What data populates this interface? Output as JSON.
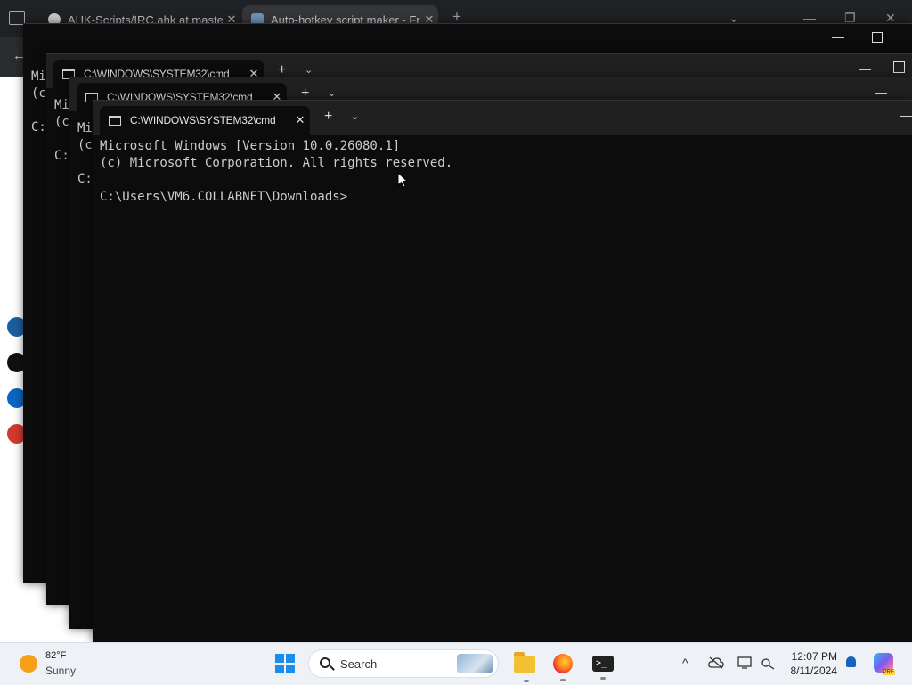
{
  "browser": {
    "tabs": [
      {
        "label": "AHK-Scripts/IRC.ahk at master"
      },
      {
        "label": "Auto-hotkey script maker - Fre"
      }
    ],
    "new_tab": "+",
    "dropdown": "⌄",
    "minimize": "—",
    "restore": "❐",
    "close": "✕",
    "back": "←"
  },
  "terminals": [
    {
      "tab_title": "C:\\WINDOWS\\SYSTEM32\\cmd",
      "lines": [
        "Mi",
        "(c",
        "",
        "C:"
      ]
    },
    {
      "tab_title": "C:\\WINDOWS\\SYSTEM32\\cmd",
      "lines": [
        "Mi",
        "(c",
        "",
        "C:"
      ]
    },
    {
      "tab_title": "C:\\WINDOWS\\SYSTEM32\\cmd",
      "lines": [
        "Mi",
        "(c",
        "",
        "C:"
      ]
    },
    {
      "tab_title": "C:\\WINDOWS\\SYSTEM32\\cmd",
      "lines": [
        "Microsoft Windows [Version 10.0.26080.1]",
        "(c) Microsoft Corporation. All rights reserved.",
        "",
        "C:\\Users\\VM6.COLLABNET\\Downloads>"
      ]
    }
  ],
  "terminal_controls": {
    "add": "+",
    "dropdown": "⌄",
    "close": "✕",
    "minimize": "—"
  },
  "taskbar": {
    "weather_temp": "82°F",
    "weather_desc": "Sunny",
    "search_placeholder": "Search",
    "tray_chevron": "^",
    "clock_time": "12:07 PM",
    "clock_date": "8/11/2024",
    "copilot_badge": "PRE"
  },
  "colors": {
    "terminal_bg": "#0c0c0c",
    "titlebar": "#202020",
    "taskbar": "#eef1f6",
    "accent": "#1a8ef0"
  },
  "icons": [
    "github-icon",
    "terminal-tab-icon",
    "windows-start-icon",
    "search-icon",
    "file-explorer-icon",
    "firefox-icon",
    "terminal-app-icon",
    "cloud-off-icon",
    "display-icon",
    "network-icon",
    "bell-icon",
    "copilot-icon"
  ]
}
